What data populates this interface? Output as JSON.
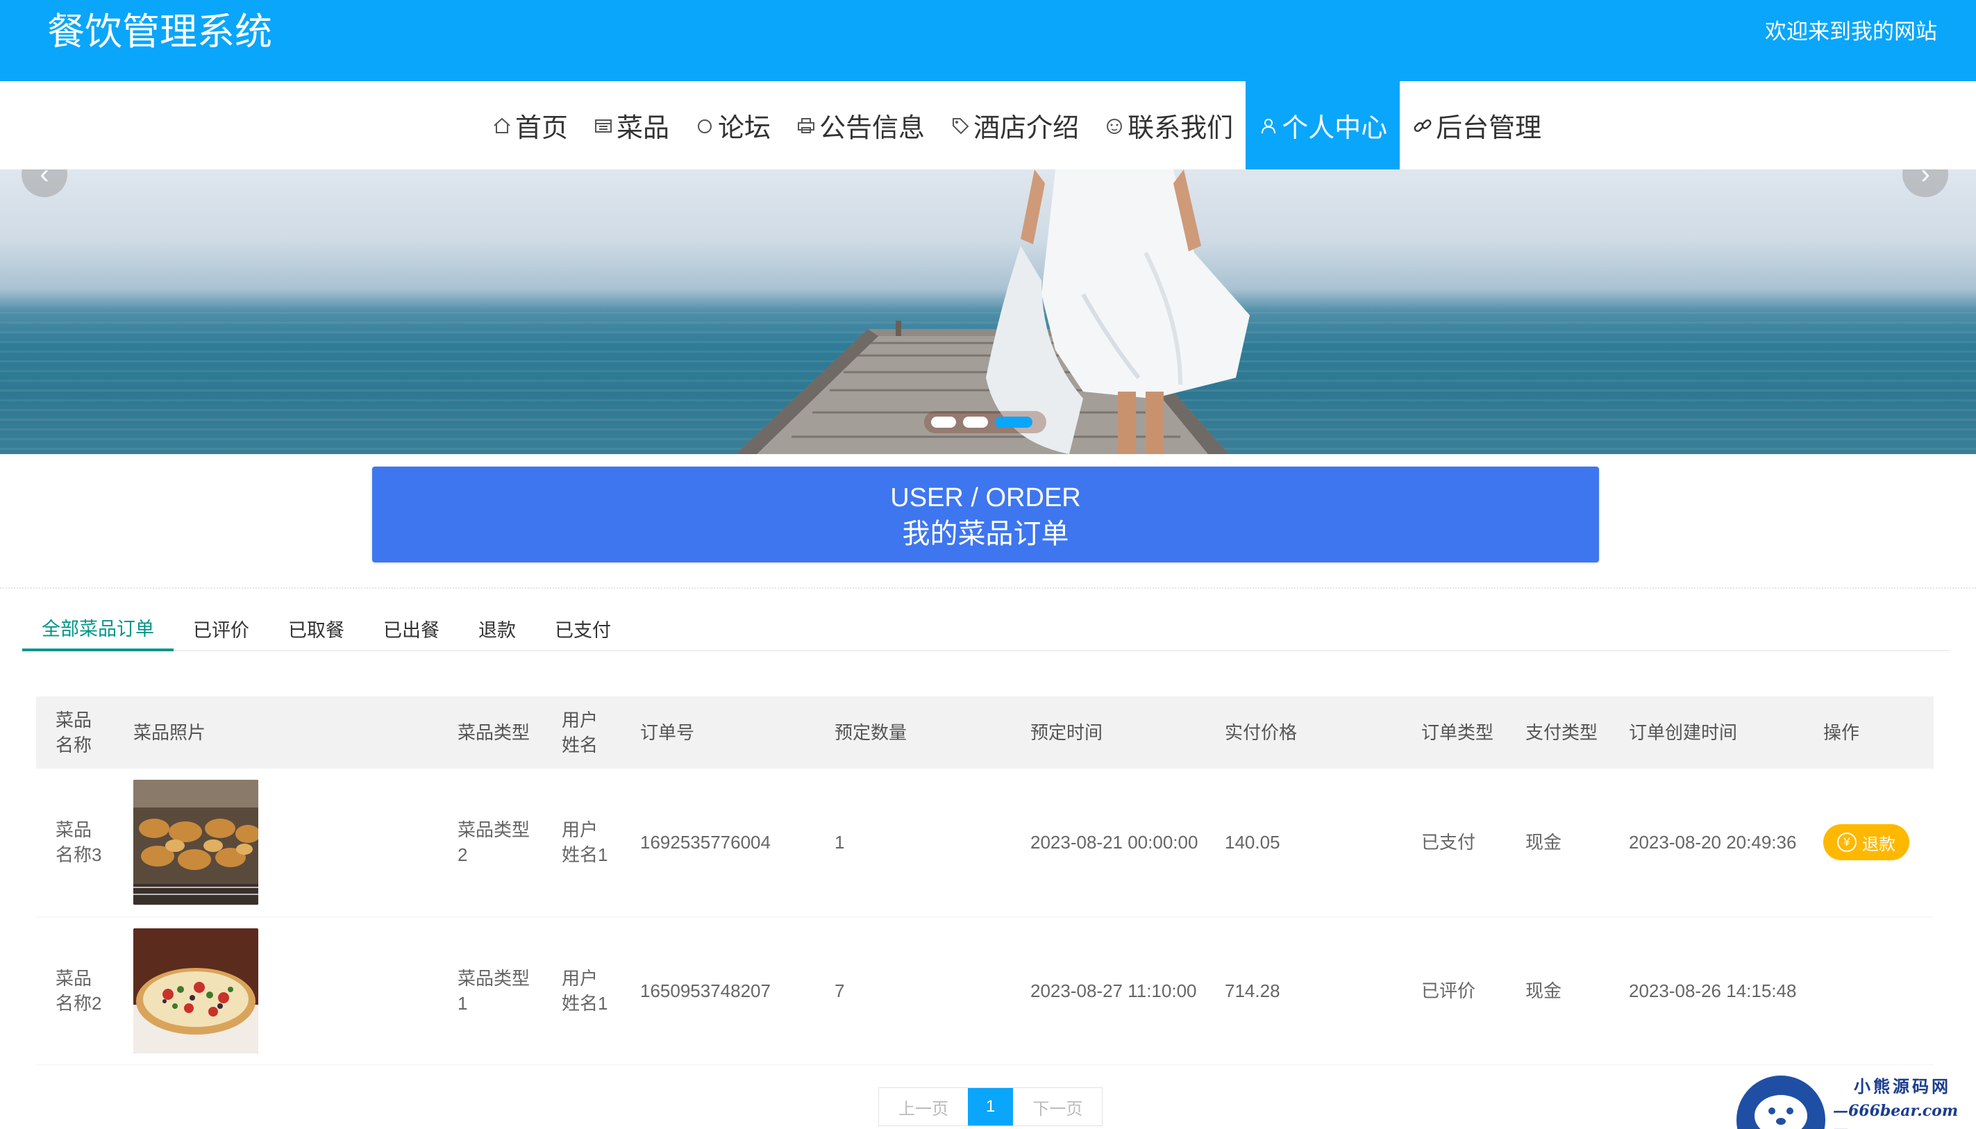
{
  "header": {
    "site_title": "餐饮管理系统",
    "welcome": "欢迎来到我的网站"
  },
  "nav": {
    "items": [
      {
        "label": "首页",
        "icon": "home-icon"
      },
      {
        "label": "菜品",
        "icon": "menu-icon"
      },
      {
        "label": "论坛",
        "icon": "forum-icon"
      },
      {
        "label": "公告信息",
        "icon": "printer-icon"
      },
      {
        "label": "酒店介绍",
        "icon": "tag-icon"
      },
      {
        "label": "联系我们",
        "icon": "face-icon"
      },
      {
        "label": "个人中心",
        "icon": "user-icon",
        "active": true
      },
      {
        "label": "后台管理",
        "icon": "link-icon"
      }
    ]
  },
  "banner": {
    "prev_arrow": "‹",
    "next_arrow": "›",
    "slide_count": 3,
    "active_slide": 3
  },
  "title_block": {
    "title_en": "USER / ORDER",
    "title_cn": "我的菜品订单"
  },
  "tabs": [
    {
      "label": "全部菜品订单",
      "active": true
    },
    {
      "label": "已评价"
    },
    {
      "label": "已取餐"
    },
    {
      "label": "已出餐"
    },
    {
      "label": "退款"
    },
    {
      "label": "已支付"
    }
  ],
  "table": {
    "columns": [
      "菜品名称",
      "菜品照片",
      "菜品类型",
      "用户姓名",
      "订单号",
      "预定数量",
      "预定时间",
      "实付价格",
      "订单类型",
      "支付类型",
      "订单创建时间",
      "操作"
    ],
    "rows": [
      {
        "name": "菜品名称3",
        "photo": "skewers-photo",
        "type": "菜品类型2",
        "user": "用户姓名1",
        "order_no": "1692535776004",
        "qty": "1",
        "reserve_time": "2023-08-21 00:00:00",
        "price": "140.05",
        "order_type": "已支付",
        "pay_type": "现金",
        "created": "2023-08-20 20:49:36",
        "action": "退款"
      },
      {
        "name": "菜品名称2",
        "photo": "pizza-photo",
        "type": "菜品类型1",
        "user": "用户姓名1",
        "order_no": "1650953748207",
        "qty": "7",
        "reserve_time": "2023-08-27 11:10:00",
        "price": "714.28",
        "order_type": "已评价",
        "pay_type": "现金",
        "created": "2023-08-26 14:15:48",
        "action": ""
      }
    ]
  },
  "pagination": {
    "prev": "上一页",
    "current": "1",
    "next": "下一页"
  },
  "watermark": {
    "line1": "小熊源码网",
    "line2": "—666bear.com—"
  },
  "colors": {
    "primary": "#09a6fb",
    "title_block": "#3e76f0",
    "tab_active": "#009688",
    "refund_button": "#ffb800"
  }
}
